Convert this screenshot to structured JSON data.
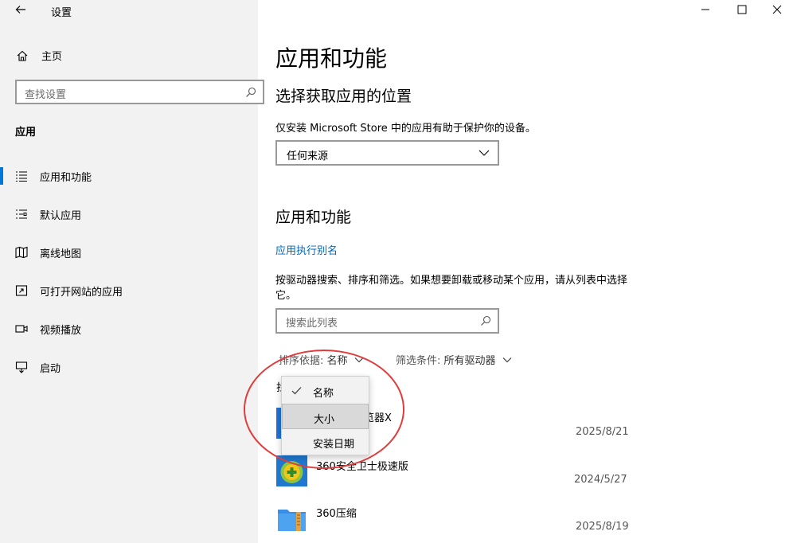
{
  "window": {
    "title": "设置",
    "controls": [
      "minimize-icon",
      "maximize-icon",
      "close-icon"
    ]
  },
  "sidebar": {
    "home_label": "主页",
    "search_placeholder": "查找设置",
    "section": "应用",
    "items": [
      {
        "label": "应用和功能",
        "icon": "list-icon",
        "active": true
      },
      {
        "label": "默认应用",
        "icon": "default-apps-icon",
        "active": false
      },
      {
        "label": "离线地图",
        "icon": "map-icon",
        "active": false
      },
      {
        "label": "可打开网站的应用",
        "icon": "open-web-icon",
        "active": false
      },
      {
        "label": "视频播放",
        "icon": "video-icon",
        "active": false
      },
      {
        "label": "启动",
        "icon": "startup-icon",
        "active": false
      }
    ]
  },
  "main": {
    "title": "应用和功能",
    "location_heading": "选择获取应用的位置",
    "location_desc": "仅安装 Microsoft Store 中的应用有助于保护你的设备。",
    "location_value": "任何来源",
    "apps_heading": "应用和功能",
    "alias_link": "应用执行别名",
    "apps_desc": "按驱动器搜索、排序和筛选。如果想要卸载或移动某个应用，请从列表中选择它。",
    "search_placeholder": "搜索此列表",
    "sort_label": "排序依据:",
    "sort_value": "名称",
    "filter_label": "筛选条件:",
    "filter_value": "所有驱动器",
    "partial_row_text": "找",
    "apps": [
      {
        "name": "2345加速浏览器X",
        "visible_name": "览器X",
        "date": "2025/8/21"
      },
      {
        "name": "360安全卫士极速版",
        "date": "2024/5/27"
      },
      {
        "name": "360压缩",
        "date": "2025/8/19"
      }
    ]
  },
  "sort_menu": {
    "items": [
      {
        "label": "名称",
        "checked": true
      },
      {
        "label": "大小",
        "checked": false,
        "hover": true
      },
      {
        "label": "安装日期",
        "checked": false
      }
    ]
  },
  "colors": {
    "accent": "#0078d7",
    "link": "#0067b8",
    "annotation": "#e03c3c"
  }
}
